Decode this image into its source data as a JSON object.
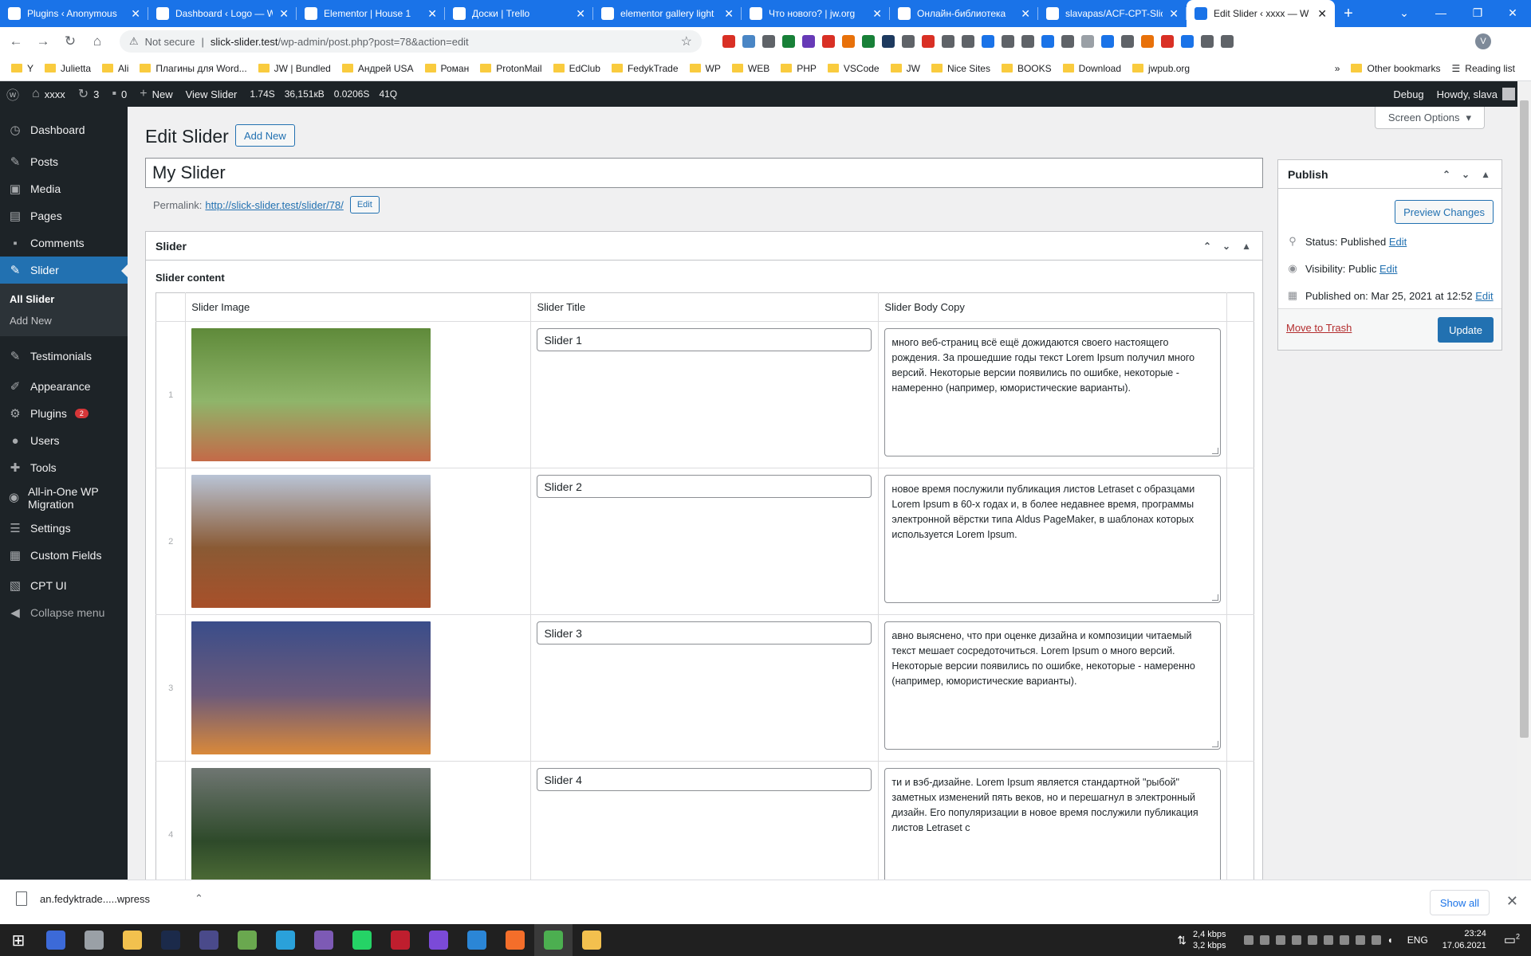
{
  "browser": {
    "tabs": [
      {
        "title": "Plugins ‹ Anonymous",
        "icon": "wordpress-icon",
        "color": "#ffffff"
      },
      {
        "title": "Dashboard ‹ Logo — W",
        "icon": "wordpress-icon",
        "color": "#ffffff"
      },
      {
        "title": "Elementor | House 1",
        "icon": "wordpress-icon",
        "color": "#ffffff"
      },
      {
        "title": "Доски | Trello",
        "icon": "trello-icon",
        "color": "#ffffff"
      },
      {
        "title": "elementor gallery light",
        "icon": "google-icon",
        "color": "#ffffff"
      },
      {
        "title": "Что нового? | jw.org",
        "icon": "jw-icon",
        "color": "#ffffff"
      },
      {
        "title": "Онлайн-библиотека",
        "icon": "jw-icon",
        "color": "#ffffff"
      },
      {
        "title": "slavapas/ACF-CPT-Slic",
        "icon": "github-icon",
        "color": "#ffffff"
      },
      {
        "title": "Edit Slider ‹ xxxx — W",
        "icon": "wordpress-icon",
        "color": "#1a73e8"
      }
    ],
    "new_tab_icon": "+",
    "address": {
      "security": "Not secure",
      "separator": "|",
      "host": "slick-slider.test",
      "path": "/wp-admin/post.php?post=78&action=edit"
    },
    "profile_initial": "V",
    "bookmarks": [
      {
        "label": "Y"
      },
      {
        "label": "Julietta"
      },
      {
        "label": "Ali"
      },
      {
        "label": "Плагины для Word..."
      },
      {
        "label": "JW | Bundled"
      },
      {
        "label": "Андрей USA"
      },
      {
        "label": "Роман"
      },
      {
        "label": "ProtonMail"
      },
      {
        "label": "EdClub"
      },
      {
        "label": "FedykTrade"
      },
      {
        "label": "WP"
      },
      {
        "label": "WEB"
      },
      {
        "label": "PHP"
      },
      {
        "label": "VSCode"
      },
      {
        "label": "JW"
      },
      {
        "label": "Nice Sites"
      },
      {
        "label": "BOOKS"
      },
      {
        "label": "Download"
      },
      {
        "label": "jwpub.org"
      }
    ],
    "bookmarks_overflow": "»",
    "other_bookmarks": "Other bookmarks",
    "reading_list": "Reading list"
  },
  "adminbar": {
    "site": "xxxx",
    "updates": "3",
    "comments": "0",
    "new": "New",
    "view": "View Slider",
    "stats": [
      "1.74S",
      "36,151кB",
      "0.0206S",
      "41Q"
    ],
    "debug": "Debug",
    "howdy": "Howdy, slava"
  },
  "sidebar": {
    "items": [
      {
        "label": "Dashboard",
        "icon": "dashboard-icon",
        "glyph": "◷"
      },
      {
        "label": "Posts",
        "icon": "pin-icon",
        "glyph": "✎"
      },
      {
        "label": "Media",
        "icon": "media-icon",
        "glyph": "▣"
      },
      {
        "label": "Pages",
        "icon": "pages-icon",
        "glyph": "▤"
      },
      {
        "label": "Comments",
        "icon": "comments-icon",
        "glyph": "▪"
      },
      {
        "label": "Slider",
        "icon": "pin-icon",
        "glyph": "✎"
      }
    ],
    "sub": {
      "all": "All Slider",
      "add": "Add New"
    },
    "items2": [
      {
        "label": "Testimonials",
        "icon": "pin-icon",
        "glyph": "✎"
      },
      {
        "label": "Appearance",
        "icon": "brush-icon",
        "glyph": "✐"
      },
      {
        "label": "Plugins",
        "icon": "plugin-icon",
        "glyph": "⚙",
        "badge": "2"
      },
      {
        "label": "Users",
        "icon": "users-icon",
        "glyph": "●"
      },
      {
        "label": "Tools",
        "icon": "tools-icon",
        "glyph": "✚"
      },
      {
        "label": "All-in-One WP Migration",
        "icon": "migration-icon",
        "glyph": "◉"
      },
      {
        "label": "Settings",
        "icon": "settings-icon",
        "glyph": "☰"
      },
      {
        "label": "Custom Fields",
        "icon": "fields-icon",
        "glyph": "▦"
      },
      {
        "label": "CPT UI",
        "icon": "cptui-icon",
        "glyph": "▧"
      },
      {
        "label": "Collapse menu",
        "icon": "collapse-icon",
        "glyph": "◀"
      }
    ]
  },
  "main": {
    "screen_options": "Screen Options",
    "title": "Edit Slider",
    "add_new": "Add New",
    "post_title": "My Slider",
    "permalink_label": "Permalink:",
    "permalink_url": "http://slick-slider.test/slider/78/",
    "permalink_edit": "Edit",
    "box_title": "Slider",
    "content_label": "Slider content",
    "columns": [
      "Slider Image",
      "Slider Title",
      "Slider Body Copy"
    ],
    "rows": [
      {
        "num": "1",
        "title": "Slider 1",
        "body": "много веб-страниц всё ещё дожидаются своего настоящего рождения. За прошедшие годы текст Lorem Ipsum получил много версий. Некоторые версии появились по ошибке, некоторые - намеренно (например, юмористические варианты).",
        "img": [
          "#5f8a3a",
          "#8fb56a",
          "#c46a48"
        ]
      },
      {
        "num": "2",
        "title": "Slider 2",
        "body": "новое время послужили публикация листов Letraset с образцами Lorem Ipsum в 60-х годах и, в более недавнее время, программы электронной вёрстки типа Aldus PageMaker, в шаблонах которых используется Lorem Ipsum.",
        "img": [
          "#b9c4d6",
          "#8a5a34",
          "#a8502a"
        ]
      },
      {
        "num": "3",
        "title": "Slider 3",
        "body": "авно выяснено, что при оценке дизайна и композиции читаемый текст мешает сосредоточиться. Lorem Ipsum  о много версий. Некоторые версии появились по ошибке, некоторые - намеренно (например, юмористические варианты).",
        "img": [
          "#3a4d8a",
          "#6c5a7a",
          "#d9893a"
        ]
      },
      {
        "num": "4",
        "title": "Slider 4",
        "body": "ти и вэб-дизайне. Lorem Ipsum является стандартной \"рыбой\" заметных изменений пять веков, но и перешагнул в электронный дизайн. Его популяризации в новое время послужили публикация листов Letraset с",
        "img": [
          "#6f7672",
          "#2e4a2a",
          "#5a7a3a"
        ]
      }
    ]
  },
  "publish": {
    "title": "Publish",
    "preview": "Preview Changes",
    "status_label": "Status:",
    "status_value": "Published",
    "visibility_label": "Visibility:",
    "visibility_value": "Public",
    "published_label": "Published on:",
    "published_value": "Mar 25, 2021 at 12:52",
    "edit": "Edit",
    "trash": "Move to Trash",
    "update": "Update"
  },
  "downloads": {
    "file": "an.fedyktrade.....wpress",
    "show_all": "Show all"
  },
  "taskbar": {
    "apps": [
      {
        "icon": "windows-start-icon",
        "color": "#ffffff"
      },
      {
        "icon": "save-icon",
        "color": "#3c6ad8"
      },
      {
        "icon": "settings-icon",
        "color": "#9aa0a6"
      },
      {
        "icon": "norton-icon",
        "color": "#f2c14e"
      },
      {
        "icon": "photoshop-icon",
        "color": "#1b2a4a"
      },
      {
        "icon": "jw-icon",
        "color": "#4a4a8a"
      },
      {
        "icon": "image-icon",
        "color": "#6aa84f"
      },
      {
        "icon": "telegram-icon",
        "color": "#2aa1da"
      },
      {
        "icon": "viber-icon",
        "color": "#7d5ab5"
      },
      {
        "icon": "whatsapp-icon",
        "color": "#25d366"
      },
      {
        "icon": "filezilla-icon",
        "color": "#bf1e2e"
      },
      {
        "icon": "phpstorm-icon",
        "color": "#7b4ad8"
      },
      {
        "icon": "vscode-icon",
        "color": "#2b86d6"
      },
      {
        "icon": "firefox-icon",
        "color": "#f46e2a"
      },
      {
        "icon": "chrome-icon",
        "color": "#4caf50"
      },
      {
        "icon": "explorer-icon",
        "color": "#f3c04e"
      }
    ],
    "net_down": "2,4 kbps",
    "net_up": "3,2 kbps",
    "lang": "ENG",
    "time": "23:24",
    "date": "17.06.2021",
    "notifications": "2"
  },
  "colors": {
    "accent": "#2271b1",
    "adminbar": "#1d2327",
    "chrome_tabbar": "#1a73e8"
  }
}
